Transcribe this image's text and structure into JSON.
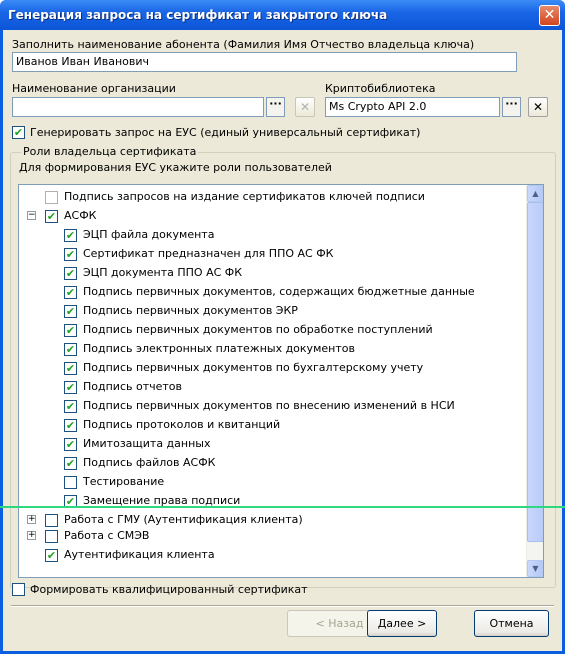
{
  "window": {
    "title": "Генерация запроса на сертификат и закрытого ключа",
    "close_glyph": "✕"
  },
  "subscriber": {
    "label": "Заполнить наименование абонента (Фамилия Имя Отчество владельца ключа)",
    "value": "Иванов Иван Иванович"
  },
  "organization": {
    "label": "Наименование организации",
    "value": "",
    "browse": "···",
    "clear": "✕"
  },
  "crypto": {
    "label": "Криптобиблиотека",
    "value": "Ms Crypto API 2.0",
    "browse": "···",
    "clear": "✕"
  },
  "eus_checkbox": {
    "label": "Генерировать запрос на ЕУС (единый универсальный сертификат)",
    "checked": true
  },
  "roles": {
    "group_title": "Роли владельца сертификата",
    "hint": "Для формирования ЕУС укажите роли пользователей",
    "items": [
      {
        "label": "Подпись запросов на издание сертификатов ключей подписи",
        "checked": false,
        "disabled": true,
        "level": 0
      },
      {
        "label": "АСФК",
        "checked": true,
        "level": 0,
        "expander": "−"
      },
      {
        "label": "ЭЦП файла документа",
        "checked": true,
        "level": 1
      },
      {
        "label": "Сертификат предназначен для ППО АС ФК",
        "checked": true,
        "level": 1
      },
      {
        "label": "ЭЦП документа ППО АС ФК",
        "checked": true,
        "level": 1
      },
      {
        "label": "Подпись первичных документов, содержащих бюджетные данные",
        "checked": true,
        "level": 1
      },
      {
        "label": "Подпись первичных документов ЭКР",
        "checked": true,
        "level": 1
      },
      {
        "label": "Подпись первичных документов по обработке поступлений",
        "checked": true,
        "level": 1
      },
      {
        "label": "Подпись электронных платежных документов",
        "checked": true,
        "level": 1
      },
      {
        "label": "Подпись первичных документов по бухгалтерскому учету",
        "checked": true,
        "level": 1
      },
      {
        "label": "Подпись отчетов",
        "checked": true,
        "level": 1
      },
      {
        "label": "Подпись первичных документов по внесению изменений в НСИ",
        "checked": true,
        "level": 1
      },
      {
        "label": "Подпись протоколов и квитанций",
        "checked": true,
        "level": 1
      },
      {
        "label": "Имитозащита данных",
        "checked": true,
        "level": 1
      },
      {
        "label": "Подпись файлов АСФК",
        "checked": true,
        "level": 1
      },
      {
        "label": "Тестирование",
        "checked": false,
        "level": 1
      },
      {
        "label": "Замещение права подписи",
        "checked": true,
        "level": 1
      },
      {
        "label": "Работа с ГМУ (Аутентификация клиента)",
        "checked": false,
        "level": 0,
        "expander": "+"
      },
      {
        "label": "Работа с СМЭВ",
        "checked": false,
        "level": 0,
        "expander": "+"
      },
      {
        "label": "Аутентификация клиента",
        "checked": true,
        "level": 0
      }
    ]
  },
  "qualified_checkbox": {
    "label": "Формировать квалифицированный сертификат",
    "checked": false
  },
  "buttons": {
    "back": "< Назад",
    "next": "Далее >",
    "cancel": "Отмена"
  },
  "scroll": {
    "up": "▲",
    "down": "▼"
  },
  "check_glyph": "✔"
}
